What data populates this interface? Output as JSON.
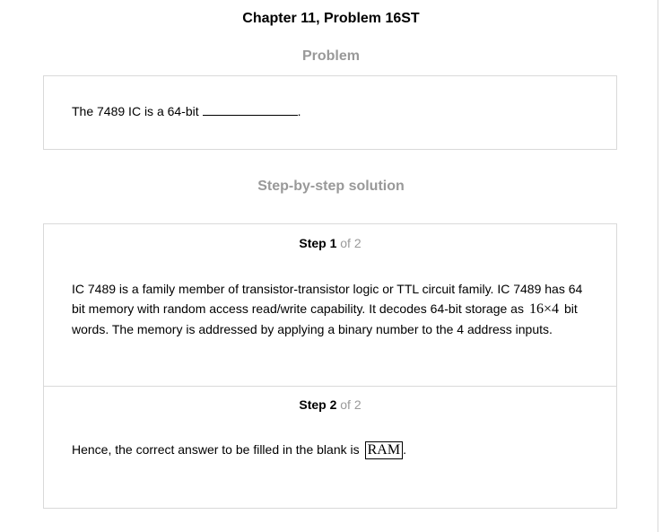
{
  "title": "Chapter 11, Problem 16ST",
  "problem": {
    "heading": "Problem",
    "text": "The 7489 IC is a 64-bit",
    "blank_end": "."
  },
  "solution": {
    "heading": "Step-by-step solution",
    "steps": [
      {
        "label": "Step 1",
        "of": "of 2",
        "line1": "IC 7489 is a family member of transistor-transistor logic or TTL circuit family. IC 7489 has 64",
        "line2_pre": "bit memory with random access read/write capability. It decodes 64-bit storage as",
        "math": "16×4",
        "line2_post": "bit",
        "line3": "words. The memory is addressed by applying a binary number to the 4 address inputs."
      },
      {
        "label": "Step 2",
        "of": "of 2",
        "text": "Hence, the correct answer to be filled in the blank is",
        "answer": "RAM",
        "end": "."
      }
    ]
  }
}
